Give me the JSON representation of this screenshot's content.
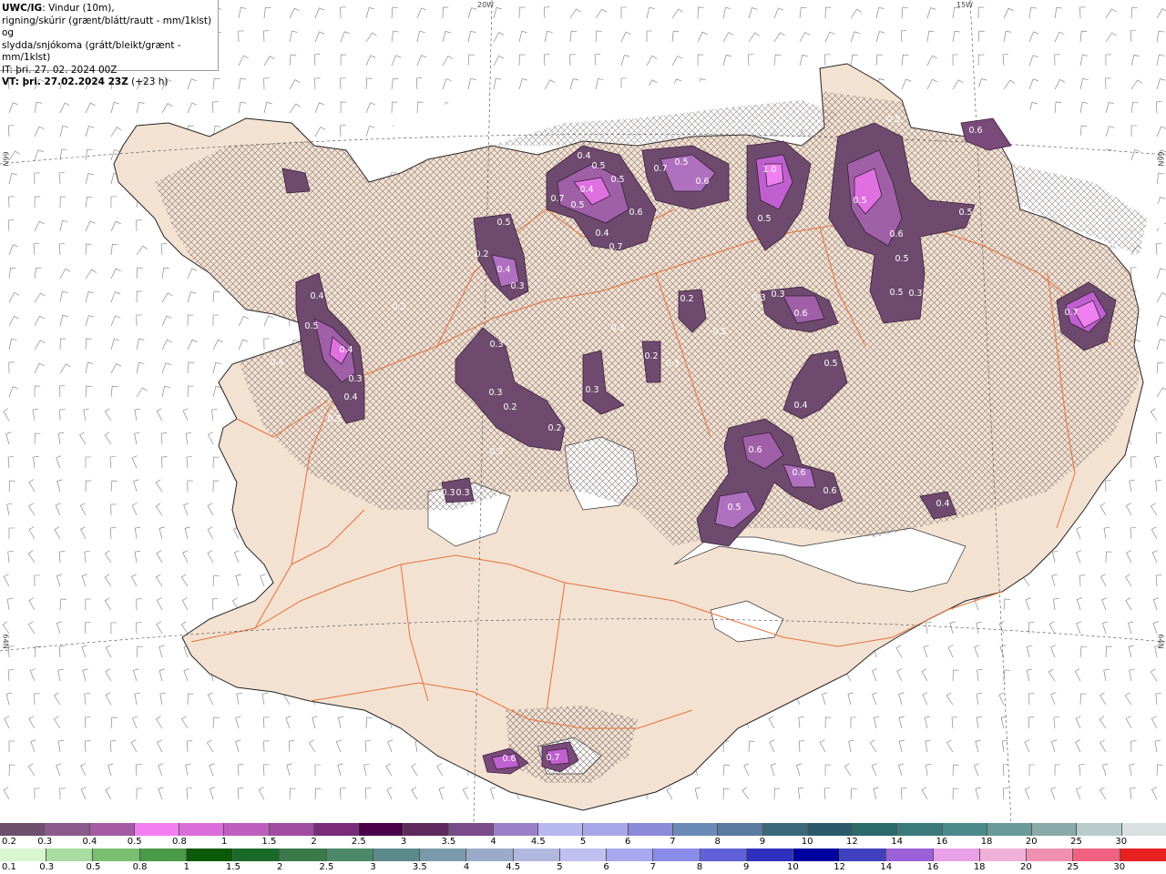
{
  "header": {
    "model": "UWC/IG",
    "line1": ": Vindur (10m),",
    "line2": "rigning/skúrir (grænt/blátt/rautt - mm/1klst) og",
    "line3": "slydda/snjókoma (grátt/bleikt/grænt - mm/1klst)",
    "it": "IT: þri. 27. 02. 2024 00Z",
    "vt_label": "VT: þri. 27.02.2024 23Z",
    "vt_offset": "(+23 h)"
  },
  "graticule": {
    "lon_labels": [
      "20W",
      "15W"
    ],
    "lat_labels": [
      "66N",
      "64N"
    ]
  },
  "precip_labels": [
    "0.4",
    "0.5",
    "0.7",
    "0.4",
    "0.5",
    "0.5",
    "0.7",
    "0.5",
    "0.6",
    "0.6",
    "0.4",
    "0.7",
    "1.0",
    "0.5",
    "0.5",
    "0.2",
    "0.4",
    "0.3",
    "0.5",
    "0.6",
    "0.5",
    "0.5",
    "0.6",
    "0.5",
    "0.5",
    "0.3",
    "0.4",
    "0.5",
    "0.4",
    "0.4",
    "0.3",
    "0.4",
    "0.3",
    "0.3",
    "0.2",
    "0.2",
    "0.3",
    "0.3",
    "0.3",
    "0.2",
    "0.5",
    "0.2",
    "0.3",
    "0.3",
    "0.3",
    "0.6",
    "0.5",
    "0.4",
    "0.6",
    "0.6",
    "0.5",
    "0.6",
    "0.4",
    "0.7",
    "0.3",
    "0.3",
    "0.6",
    "0.7",
    "0.3",
    "0.3",
    "0.3"
  ],
  "legend_snow": {
    "labels": [
      "0.2",
      "0.3",
      "0.4",
      "0.5",
      "0.8",
      "1",
      "1.5",
      "2",
      "2.5",
      "3",
      "3.5",
      "4",
      "4.5",
      "5",
      "6",
      "7",
      "8",
      "9",
      "10",
      "12",
      "14",
      "16",
      "18",
      "20",
      "25",
      "30"
    ],
    "colors": [
      "#6e4f6e",
      "#8a5a8a",
      "#a45aa4",
      "#f27ef2",
      "#dc6edc",
      "#c05ec0",
      "#a04ca0",
      "#7a2a7a",
      "#4a004a",
      "#5e2a5e",
      "#7a4a8a",
      "#9a80c8",
      "#b8b8f0",
      "#a6a6e8",
      "#8a8ad8",
      "#6a8ab8",
      "#5a7aa0",
      "#3a6a7a",
      "#2a5a6a",
      "#2a6a6a",
      "#3a7a7a",
      "#4a8a8a",
      "#6a9a9a",
      "#8aaaaa",
      "#b8cccc",
      "#d8e0e0"
    ]
  },
  "legend_rain": {
    "labels": [
      "0.1",
      "0.3",
      "0.5",
      "0.8",
      "1",
      "1.5",
      "2",
      "2.5",
      "3",
      "3.5",
      "4",
      "4.5",
      "5",
      "6",
      "7",
      "8",
      "9",
      "10",
      "12",
      "14",
      "16",
      "18",
      "20",
      "25",
      "30"
    ],
    "colors": [
      "#d8f5d0",
      "#a8dca0",
      "#78c070",
      "#4a9a48",
      "#0a5a0a",
      "#1a6a2a",
      "#3a7a4a",
      "#4a8a6a",
      "#5a8a8a",
      "#7a9aaa",
      "#9aaac8",
      "#b0b8e0",
      "#c0c0f0",
      "#a8a8f0",
      "#8a8ae8",
      "#6060d8",
      "#3030c0",
      "#0000a0",
      "#4040c0",
      "#9a60d8",
      "#e8a0e8",
      "#f0b0d8",
      "#f090b0",
      "#f06080",
      "#e82020"
    ]
  }
}
